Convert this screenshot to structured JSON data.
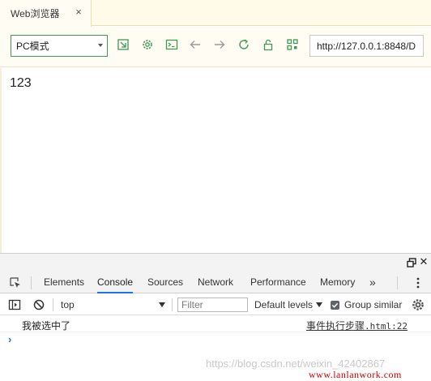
{
  "tab": {
    "title": "Web浏览器",
    "close_glyph": "×"
  },
  "toolbar": {
    "mode": "PC模式",
    "url": "http://127.0.0.1:8848/D",
    "icons": [
      "open-external-icon",
      "gear-icon",
      "terminal-icon",
      "back-arrow-icon",
      "forward-arrow-icon",
      "refresh-icon",
      "lock-icon",
      "qr-code-icon"
    ]
  },
  "page": {
    "text": "123"
  },
  "devtools": {
    "tabs": [
      "Elements",
      "Console",
      "Sources",
      "Network",
      "Performance",
      "Memory"
    ],
    "active_tab": "Console",
    "more_glyph": "»",
    "close_glyph": "✕",
    "context": "top",
    "filter_placeholder": "Filter",
    "levels": "Default levels",
    "group_similar": "Group similar",
    "group_similar_checked": true,
    "message": {
      "text": "我被选中了",
      "source_name": "事件执行步骤",
      "source_file": ".html:22"
    },
    "prompt": "›"
  },
  "watermark": "https://blog.csdn.net/weixin_42402867",
  "brand": "www.lanlanwork.com",
  "colors": {
    "accent_green": "#3c9a54",
    "tab_active": "#1a73e8",
    "brand_red": "#cc0000"
  }
}
